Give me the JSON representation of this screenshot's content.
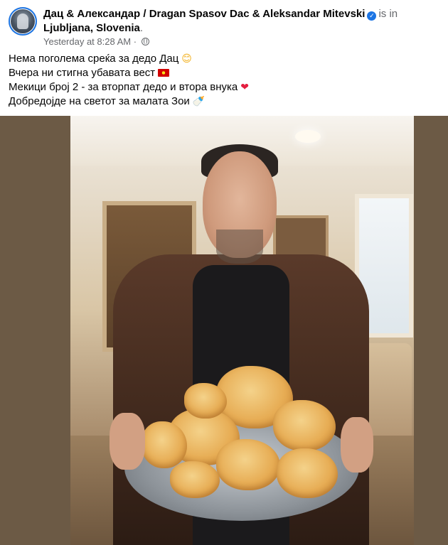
{
  "post": {
    "header": {
      "author": "Дац & Александар / Dragan Spasov Dac & Aleksandar Mitevski",
      "location_prefix": "is in",
      "location": "Ljubljana, Slovenia",
      "location_suffix": ".",
      "timestamp": "Yesterday at 8:28 AM",
      "timestamp_separator": "·",
      "audience_icon": "globe-icon",
      "verified_icon": "verified-badge-icon"
    },
    "message": {
      "lines": [
        {
          "text": "Нема поголема среќа за дедо Дац",
          "emoji": "😊",
          "emoji_icon": "smiling-face-icon"
        },
        {
          "text": "Вчера ни стигна убавата вест",
          "emoji_icon": "macedonia-flag-icon"
        },
        {
          "text": "Мекици број 2 - за вторпат дедо и втора внука",
          "emoji": "❤",
          "emoji_icon": "red-heart-icon"
        },
        {
          "text": "Добредојде на светот за малата Зои",
          "emoji": "🍼",
          "emoji_icon": "baby-bottle-icon"
        }
      ]
    },
    "media": {
      "photo_subject": "man-holding-tray-of-mekici-icon"
    },
    "colors": {
      "link_blue": "#1b74e4",
      "muted_text": "#65676b",
      "text": "#050505",
      "heart": "#e41e3f",
      "media_background": "#6c5a45"
    }
  }
}
